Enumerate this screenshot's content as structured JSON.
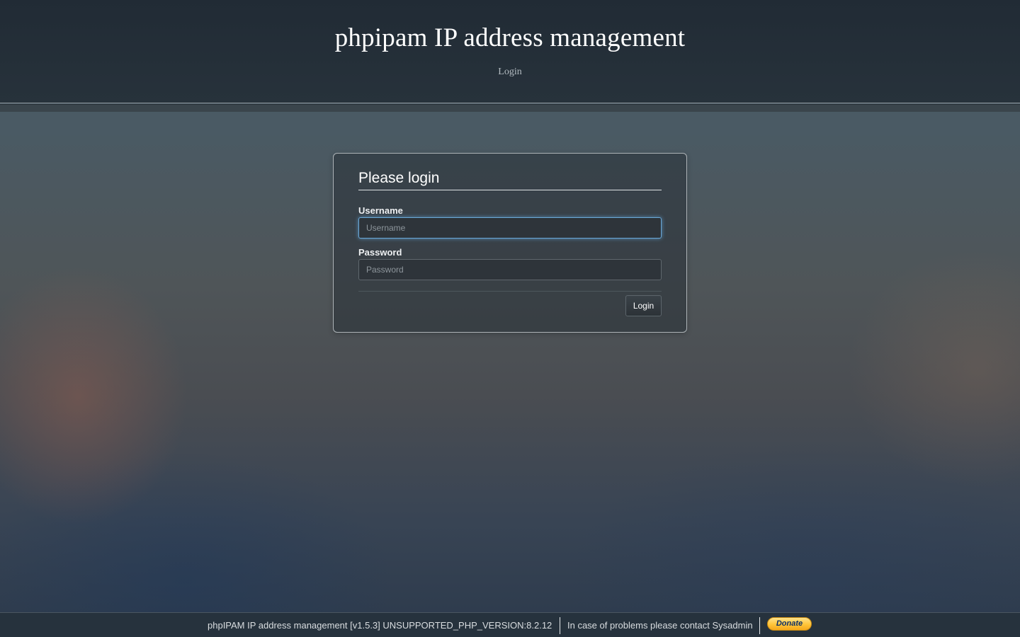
{
  "header": {
    "title": "phpipam IP address management",
    "subtitle": "Login"
  },
  "login": {
    "legend": "Please login",
    "username_label": "Username",
    "username_placeholder": "Username",
    "username_value": "",
    "password_label": "Password",
    "password_placeholder": "Password",
    "password_value": "",
    "submit_label": "Login"
  },
  "footer": {
    "version_text": "phpIPAM IP address management [v1.5.3] UNSUPPORTED_PHP_VERSION:8.2.12",
    "contact_text": "In case of problems please contact Sysadmin",
    "donate_label": "Donate"
  },
  "colors": {
    "header_bg": "#212b35",
    "focus_ring": "#66afe9",
    "donate_gold": "#ffc439"
  }
}
